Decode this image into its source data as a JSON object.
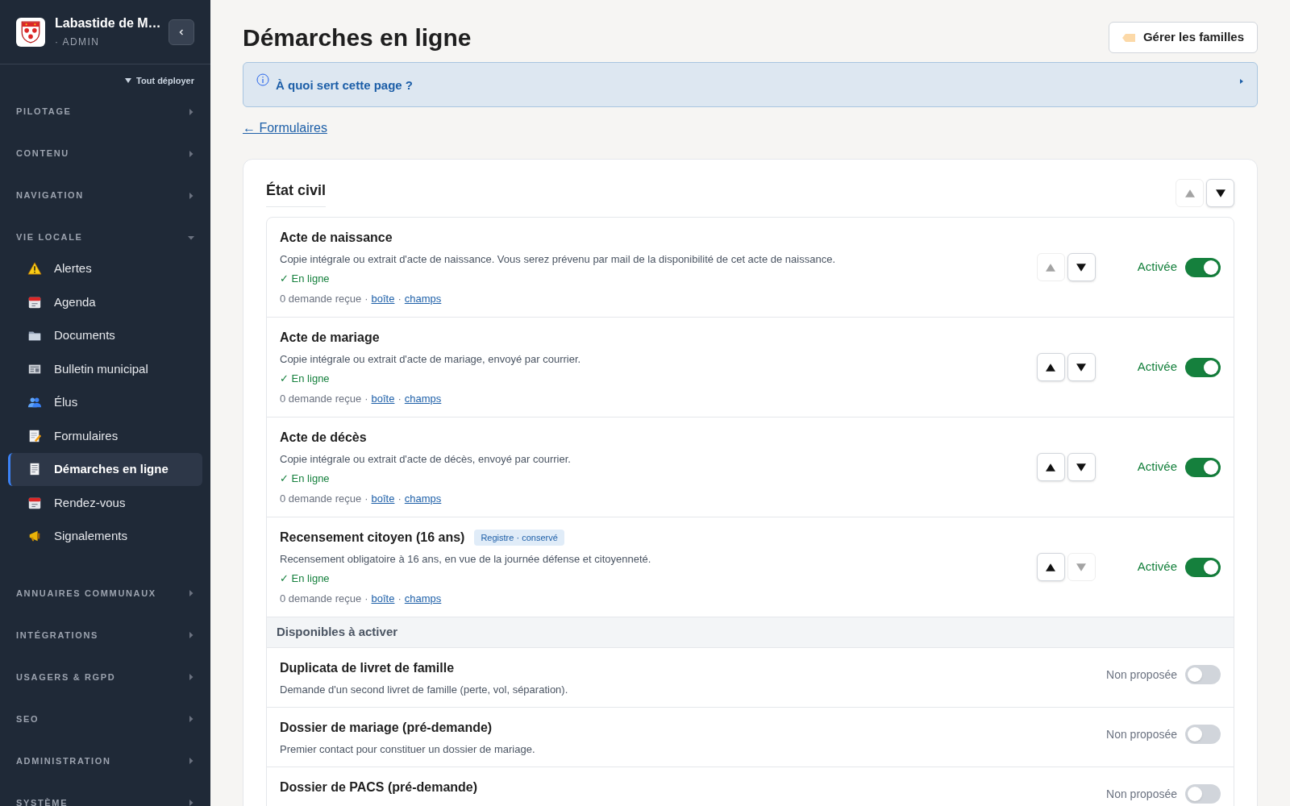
{
  "sidebar": {
    "site_name": "Labastide de M…",
    "role": "· ADMIN",
    "expand_all": "Tout déployer",
    "sections": [
      {
        "label": "PILOTAGE",
        "expanded": false
      },
      {
        "label": "CONTENU",
        "expanded": false
      },
      {
        "label": "NAVIGATION",
        "expanded": false
      },
      {
        "label": "VIE LOCALE",
        "expanded": true,
        "items": [
          {
            "label": "Alertes",
            "kind": "warning",
            "selected": false
          },
          {
            "label": "Agenda",
            "kind": "calendar",
            "selected": false
          },
          {
            "label": "Documents",
            "kind": "folder",
            "selected": false
          },
          {
            "label": "Bulletin municipal",
            "kind": "newspaper",
            "selected": false
          },
          {
            "label": "Élus",
            "kind": "people",
            "selected": false
          },
          {
            "label": "Formulaires",
            "kind": "memo",
            "selected": false
          },
          {
            "label": "Démarches en ligne",
            "kind": "page",
            "selected": true
          },
          {
            "label": "Rendez-vous",
            "kind": "calendar",
            "selected": false
          },
          {
            "label": "Signalements",
            "kind": "megaphone",
            "selected": false
          }
        ]
      },
      {
        "label": "ANNUAIRES COMMUNAUX",
        "expanded": false
      },
      {
        "label": "INTÉGRATIONS",
        "expanded": false
      },
      {
        "label": "USAGERS & RGPD",
        "expanded": false
      },
      {
        "label": "SEO",
        "expanded": false
      },
      {
        "label": "ADMINISTRATION",
        "expanded": false
      },
      {
        "label": "SYSTÈME",
        "expanded": false
      }
    ]
  },
  "separator": "·",
  "page": {
    "title": "Démarches en ligne",
    "manage_button": "Gérer les familles",
    "help": "À quoi sert cette page ?",
    "back_link": "← Formulaires"
  },
  "family": {
    "title": "État civil",
    "up_disabled": true,
    "down_disabled": false,
    "active": [
      {
        "title": "Acte de naissance",
        "description": "Copie intégrale ou extrait d'acte de naissance. Vous serez prévenu par mail de la disponibilité de cet acte de naissance.",
        "status": "✓ En ligne",
        "count": "0 demande reçue",
        "box_link": "boîte",
        "fields_link": "champs",
        "up_disabled": true,
        "down_disabled": false,
        "state_label": "Activée",
        "on": true
      },
      {
        "title": "Acte de mariage",
        "description": "Copie intégrale ou extrait d'acte de mariage, envoyé par courrier.",
        "status": "✓ En ligne",
        "count": "0 demande reçue",
        "box_link": "boîte",
        "fields_link": "champs",
        "up_disabled": false,
        "down_disabled": false,
        "state_label": "Activée",
        "on": true
      },
      {
        "title": "Acte de décès",
        "description": "Copie intégrale ou extrait d'acte de décès, envoyé par courrier.",
        "status": "✓ En ligne",
        "count": "0 demande reçue",
        "box_link": "boîte",
        "fields_link": "champs",
        "up_disabled": false,
        "down_disabled": false,
        "state_label": "Activée",
        "on": true
      },
      {
        "title": "Recensement citoyen (16 ans)",
        "badge": "Registre · conservé",
        "description": "Recensement obligatoire à 16 ans, en vue de la journée défense et citoyenneté.",
        "status": "✓ En ligne",
        "count": "0 demande reçue",
        "box_link": "boîte",
        "fields_link": "champs",
        "up_disabled": false,
        "down_disabled": true,
        "state_label": "Activée",
        "on": true
      }
    ],
    "available_title": "Disponibles à activer",
    "available": [
      {
        "title": "Duplicata de livret de famille",
        "description": "Demande d'un second livret de famille (perte, vol, séparation).",
        "state_label": "Non proposée",
        "on": false
      },
      {
        "title": "Dossier de mariage (pré-demande)",
        "description": "Premier contact pour constituer un dossier de mariage.",
        "state_label": "Non proposée",
        "on": false
      },
      {
        "title": "Dossier de PACS (pré-demande)",
        "state_label": "Non proposée",
        "on": false
      }
    ]
  }
}
